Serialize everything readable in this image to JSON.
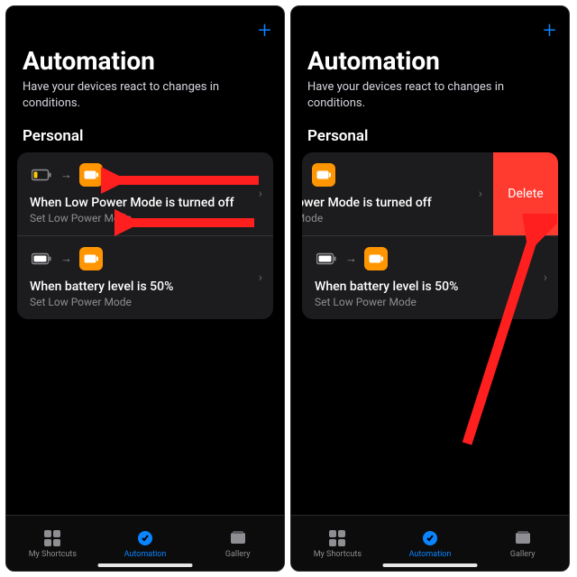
{
  "common": {
    "plus_label": "+",
    "title": "Automation",
    "subtitle": "Have your devices react to changes in conditions.",
    "section": "Personal",
    "tabs": {
      "shortcuts": "My Shortcuts",
      "automation": "Automation",
      "gallery": "Gallery"
    }
  },
  "left": {
    "row1": {
      "title": "When Low Power Mode is turned off",
      "sub": "Set Low Power Mode"
    },
    "row2": {
      "title": "When battery level is 50%",
      "sub": "Set Low Power Mode"
    }
  },
  "right": {
    "row1": {
      "title_fragment": "Low Power Mode is turned off",
      "sub_fragment": "Power Mode",
      "delete_label": "Delete"
    },
    "row2": {
      "title": "When battery level is 50%",
      "sub": "Set Low Power Mode"
    }
  },
  "colors": {
    "accent_blue": "#0a84ff",
    "orange": "#ff9500",
    "destructive": "#ff3b30",
    "arrow_red": "#ff1f1f"
  }
}
